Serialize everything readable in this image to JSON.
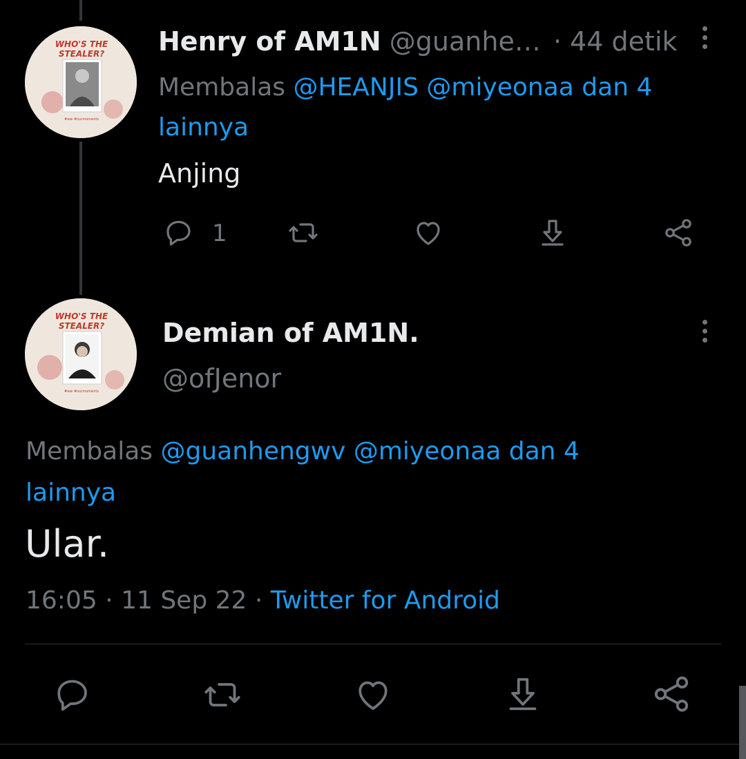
{
  "reply_tweet": {
    "display_name": "Henry of AM1N",
    "handle": "@guanhe…",
    "separator": "·",
    "time": "44 detik",
    "replying_prefix": "Membalas",
    "replying_mentions": "@HEANJIS @miyeonaa dan 4",
    "replying_mentions_2": "lainnya",
    "text": "Anjing",
    "reply_count": "1",
    "avatar_text": "WHO'S THE STEALER?"
  },
  "main_tweet": {
    "display_name": "Demian of AM1N.",
    "handle": "@ofJenor",
    "replying_prefix": "Membalas",
    "replying_mentions": "@guanhengwv @miyeonaa dan 4",
    "replying_mentions_2": "lainnya",
    "text": "Ular.",
    "timestamp": "16:05 · 11 Sep 22 ·",
    "source": "Twitter for Android",
    "avatar_text": "WHO'S THE STEALER?"
  },
  "icons": {
    "reply": "reply-icon",
    "retweet": "retweet-icon",
    "like": "heart-icon",
    "share": "share-icon",
    "save": "download-icon",
    "more": "more-icon"
  },
  "colors": {
    "background": "#000000",
    "text": "#e7e9ea",
    "muted": "#71767b",
    "link": "#1d9bf0"
  }
}
